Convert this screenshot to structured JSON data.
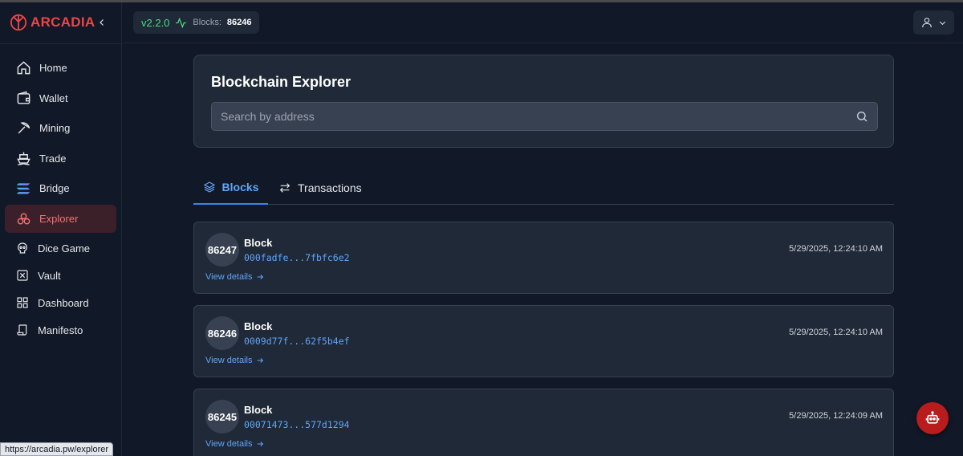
{
  "brand": {
    "name": "ARCADIA"
  },
  "header": {
    "version": "v2.2.0",
    "blocks_label": "Blocks:",
    "blocks_count": "86246"
  },
  "sidebar": {
    "items": [
      {
        "label": "Home",
        "icon": "home-icon"
      },
      {
        "label": "Wallet",
        "icon": "wallet-icon"
      },
      {
        "label": "Mining",
        "icon": "pickaxe-icon"
      },
      {
        "label": "Trade",
        "icon": "ship-icon"
      },
      {
        "label": "Bridge",
        "icon": "solana-icon"
      },
      {
        "label": "Explorer",
        "icon": "explorer-icon",
        "active": true
      },
      {
        "label": "Dice Game",
        "icon": "skull-icon"
      },
      {
        "label": "Vault",
        "icon": "vault-icon"
      },
      {
        "label": "Dashboard",
        "icon": "dashboard-icon"
      },
      {
        "label": "Manifesto",
        "icon": "scroll-icon"
      }
    ]
  },
  "explorer": {
    "title": "Blockchain Explorer",
    "search_placeholder": "Search by address"
  },
  "tabs": [
    {
      "label": "Blocks",
      "icon": "layers-icon",
      "active": true
    },
    {
      "label": "Transactions",
      "icon": "arrows-exchange-icon"
    }
  ],
  "blocks": [
    {
      "number": "86247",
      "label": "Block",
      "hash": "000fadfe...7fbfc6e2",
      "time": "5/29/2025, 12:24:10 AM",
      "link": "View details"
    },
    {
      "number": "86246",
      "label": "Block",
      "hash": "0009d77f...62f5b4ef",
      "time": "5/29/2025, 12:24:10 AM",
      "link": "View details"
    },
    {
      "number": "86245",
      "label": "Block",
      "hash": "00071473...577d1294",
      "time": "5/29/2025, 12:24:09 AM",
      "link": "View details"
    }
  ],
  "status_bar": {
    "url": "https://arcadia.pw/explorer"
  },
  "colors": {
    "accent": "#ef4444",
    "link": "#60a5fa",
    "version": "#4ade80",
    "background": "#111827",
    "card": "#1f2937"
  }
}
